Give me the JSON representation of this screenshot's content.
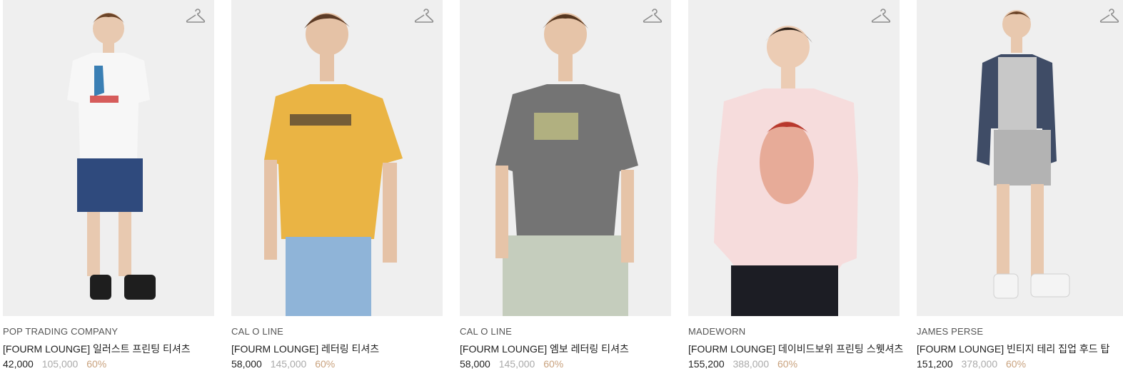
{
  "products": [
    {
      "brand": "POP TRADING COMPANY",
      "title": "[FOURM LOUNGE] 일러스트 프린팅 티셔츠",
      "price": "42,000",
      "original_price": "105,000",
      "discount": "60%",
      "shirt_color": "#f7f7f7",
      "bottom_color": "#2f4a7d",
      "icon": "hanger-icon"
    },
    {
      "brand": "CAL O LINE",
      "title": "[FOURM LOUNGE] 레터링 티셔츠",
      "price": "58,000",
      "original_price": "145,000",
      "discount": "60%",
      "shirt_color": "#eab444",
      "bottom_color": "#8fb4d8",
      "icon": "hanger-icon"
    },
    {
      "brand": "CAL O LINE",
      "title": "[FOURM LOUNGE] 엠보 레터링 티셔츠",
      "price": "58,000",
      "original_price": "145,000",
      "discount": "60%",
      "shirt_color": "#747474",
      "bottom_color": "#c5cdbd",
      "icon": "hanger-icon"
    },
    {
      "brand": "MADEWORN",
      "title": "[FOURM LOUNGE] 데이비드보위 프린팅 스웻셔츠",
      "price": "155,200",
      "original_price": "388,000",
      "discount": "60%",
      "shirt_color": "#f6dcdc",
      "bottom_color": "#1c1d24",
      "icon": "hanger-icon"
    },
    {
      "brand": "JAMES PERSE",
      "title": "[FOURM LOUNGE] 빈티지 테리 집업 후드 탑",
      "price": "151,200",
      "original_price": "378,000",
      "discount": "60%",
      "shirt_color": "#3f4c66",
      "bottom_color": "#b3b3b3",
      "icon": "hanger-icon"
    }
  ]
}
